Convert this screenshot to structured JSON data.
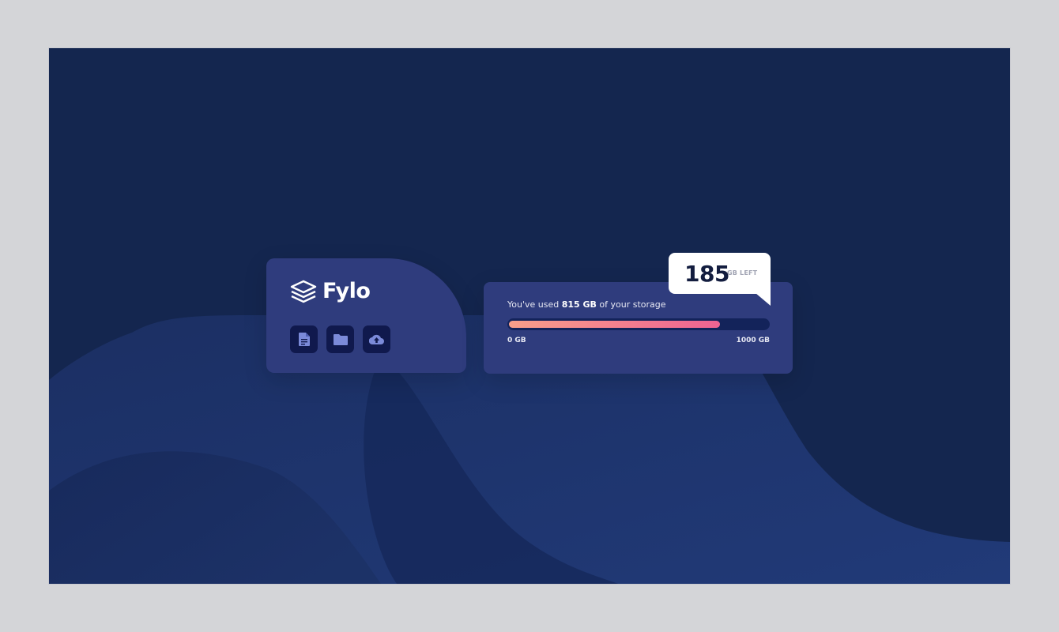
{
  "logo": {
    "name": "Fylo"
  },
  "actions": [
    {
      "icon": "document-icon"
    },
    {
      "icon": "folder-icon"
    },
    {
      "icon": "cloud-upload-icon"
    }
  ],
  "usage": {
    "text_prefix": "You've used ",
    "used_value": "815 GB",
    "text_suffix": " of your storage",
    "used_fraction": 0.815,
    "min_label": "0 GB",
    "max_label": "1000 GB"
  },
  "remaining": {
    "value": "185",
    "unit": "GB LEFT"
  },
  "colors": {
    "background": "#14264f",
    "card": "#2f3c7d",
    "icon_button": "#10194d",
    "gradient_start": "#f89f8a",
    "gradient_end": "#ef6392"
  }
}
